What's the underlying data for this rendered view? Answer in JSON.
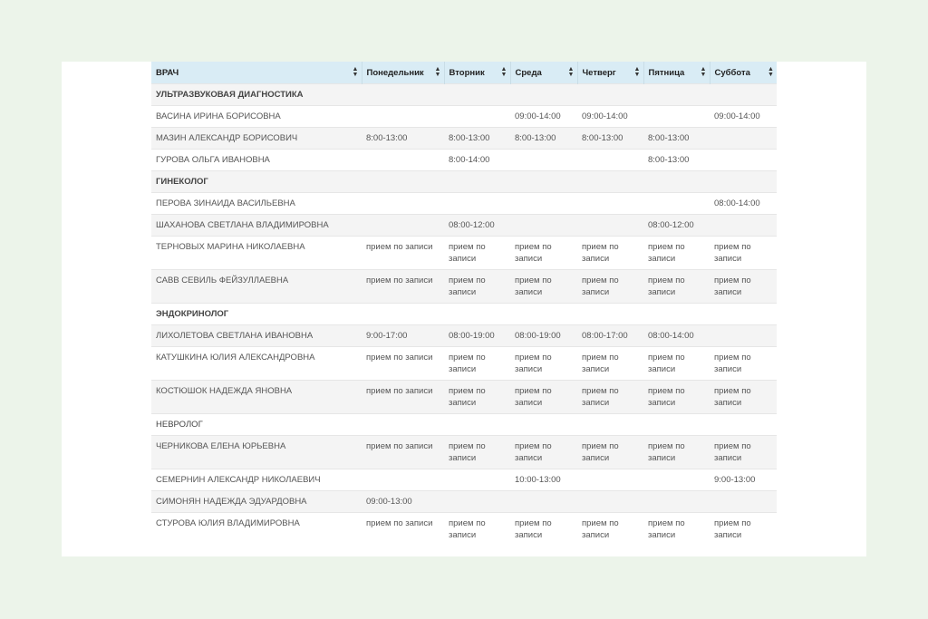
{
  "header": {
    "columns": [
      "ВРАЧ",
      "Понедельник",
      "Вторник",
      "Среда",
      "Четверг",
      "Пятница",
      "Суббота"
    ]
  },
  "rows": [
    {
      "kind": "section",
      "name": "УЛЬТРАЗВУКОВАЯ ДИАГНОСТИКА",
      "bold": true
    },
    {
      "kind": "doctor",
      "name": "ВАСИНА ИРИНА БОРИСОВНА",
      "days": [
        "",
        "",
        "09:00-14:00",
        "09:00-14:00",
        "",
        "09:00-14:00"
      ]
    },
    {
      "kind": "doctor",
      "name": "МАЗИН АЛЕКСАНДР БОРИСОВИЧ",
      "days": [
        "8:00-13:00",
        "8:00-13:00",
        "8:00-13:00",
        "8:00-13:00",
        "8:00-13:00",
        ""
      ]
    },
    {
      "kind": "doctor",
      "name": "ГУРОВА ОЛЬГА ИВАНОВНА",
      "days": [
        "",
        "8:00-14:00",
        "",
        "",
        "8:00-13:00",
        ""
      ]
    },
    {
      "kind": "section",
      "name": "ГИНЕКОЛОГ",
      "bold": true
    },
    {
      "kind": "doctor",
      "name": "ПЕРОВА ЗИНАИДА ВАСИЛЬЕВНА",
      "days": [
        "",
        "",
        "",
        "",
        "",
        "08:00-14:00"
      ]
    },
    {
      "kind": "doctor",
      "name": "ШАХАНОВА СВЕТЛАНА ВЛАДИМИРОВНА",
      "days": [
        "",
        "08:00-12:00",
        "",
        "",
        "08:00-12:00",
        ""
      ]
    },
    {
      "kind": "doctor",
      "name": "ТЕРНОВЫХ МАРИНА НИКОЛАЕВНА",
      "days": [
        "прием по записи",
        "прием по записи",
        "прием по записи",
        "прием по записи",
        "прием по записи",
        "прием по записи"
      ]
    },
    {
      "kind": "doctor",
      "name": "САВВ СЕВИЛЬ ФЕЙЗУЛЛАЕВНА",
      "days": [
        "прием по записи",
        "прием по записи",
        "прием по записи",
        "прием по записи",
        "прием по записи",
        "прием по записи"
      ]
    },
    {
      "kind": "section",
      "name": "ЭНДОКРИНОЛОГ",
      "bold": true
    },
    {
      "kind": "doctor",
      "name": "ЛИХОЛЕТОВА СВЕТЛАНА ИВАНОВНА",
      "days": [
        "9:00-17:00",
        "08:00-19:00",
        "08:00-19:00",
        "08:00-17:00",
        "08:00-14:00",
        ""
      ]
    },
    {
      "kind": "doctor",
      "name": "КАТУШКИНА ЮЛИЯ АЛЕКСАНДРОВНА",
      "days": [
        "прием по записи",
        "прием по записи",
        "прием по записи",
        "прием по записи",
        "прием по записи",
        "прием по записи"
      ]
    },
    {
      "kind": "doctor",
      "name": "КОСТЮШОК НАДЕЖДА ЯНОВНА",
      "days": [
        "прием по записи",
        "прием по записи",
        "прием по записи",
        "прием по записи",
        "прием по записи",
        "прием по записи"
      ]
    },
    {
      "kind": "section",
      "name": "НЕВРОЛОГ",
      "bold": false
    },
    {
      "kind": "doctor",
      "name": "ЧЕРНИКОВА ЕЛЕНА ЮРЬЕВНА",
      "days": [
        "прием по записи",
        "прием по записи",
        "прием по записи",
        "прием по записи",
        "прием по записи",
        "прием по записи"
      ]
    },
    {
      "kind": "doctor",
      "name": "СЕМЕРНИН АЛЕКСАНДР НИКОЛАЕВИЧ",
      "days": [
        "",
        "",
        "10:00-13:00",
        "",
        "",
        "9:00-13:00"
      ]
    },
    {
      "kind": "doctor",
      "name": "СИМОНЯН НАДЕЖДА ЭДУАРДОВНА",
      "days": [
        "09:00-13:00",
        "",
        "",
        "",
        "",
        ""
      ]
    },
    {
      "kind": "doctor",
      "name": "СТУРОВА ЮЛИЯ ВЛАДИМИРОВНА",
      "days": [
        "прием по записи",
        "прием по записи",
        "прием по записи",
        "прием по записи",
        "прием по записи",
        "прием по записи"
      ]
    }
  ],
  "colors": {
    "page_background": "#ecf4ea",
    "header_background": "#d9ecf5",
    "row_stripe": "#f4f4f4"
  },
  "icons": {
    "sort": "sort-arrows-icon"
  }
}
